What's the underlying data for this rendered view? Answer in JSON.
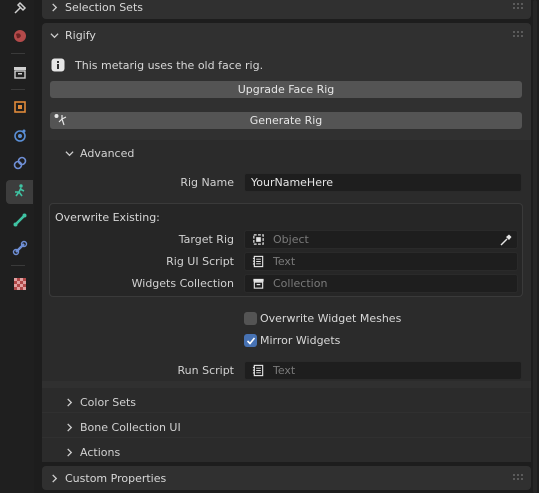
{
  "panels": {
    "selection_sets": {
      "title": "Selection Sets"
    },
    "rigify": {
      "title": "Rigify",
      "info_message": "This metarig uses the old face rig.",
      "upgrade_button": "Upgrade Face Rig",
      "generate_button": "Generate Rig",
      "advanced": {
        "title": "Advanced",
        "rig_name_label": "Rig Name",
        "rig_name_value": "YourNameHere",
        "overwrite_title": "Overwrite Existing:",
        "target_rig_label": "Target Rig",
        "target_rig_placeholder": "Object",
        "rig_ui_script_label": "Rig UI Script",
        "rig_ui_script_placeholder": "Text",
        "widgets_collection_label": "Widgets Collection",
        "widgets_collection_placeholder": "Collection",
        "overwrite_widget_meshes_label": "Overwrite Widget Meshes",
        "overwrite_widget_meshes_checked": false,
        "mirror_widgets_label": "Mirror Widgets",
        "mirror_widgets_checked": true,
        "run_script_label": "Run Script",
        "run_script_placeholder": "Text"
      },
      "subpanels": [
        "Color Sets",
        "Bone Collection UI",
        "Actions"
      ]
    },
    "custom_properties": {
      "title": "Custom Properties"
    }
  },
  "tabs": [
    {
      "icon": "tool-icon",
      "active": false
    },
    {
      "icon": "world-icon",
      "active": false
    },
    {
      "icon": "collection-icon",
      "active": false
    },
    {
      "icon": "object-icon",
      "active": false
    },
    {
      "icon": "physics-icon",
      "active": false
    },
    {
      "icon": "constraints-icon",
      "active": false
    },
    {
      "icon": "armature-data-icon",
      "active": true
    },
    {
      "icon": "bone-icon",
      "active": false
    },
    {
      "icon": "bone-constraint-icon",
      "active": false
    },
    {
      "icon": "texture-icon",
      "active": false
    }
  ],
  "colors": {
    "accent": "#4772b3",
    "panel_bg": "#303030",
    "field_bg": "#1e1e1e",
    "button_bg": "#545454"
  }
}
